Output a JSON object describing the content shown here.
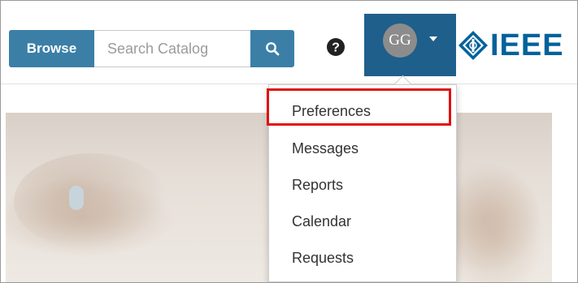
{
  "header": {
    "browse_label": "Browse",
    "search_placeholder": "Search Catalog",
    "user_initials": "GG",
    "logo_text": "IEEE"
  },
  "menu": {
    "items": [
      {
        "label": "Preferences"
      },
      {
        "label": "Messages"
      },
      {
        "label": "Reports"
      },
      {
        "label": "Calendar"
      },
      {
        "label": "Requests"
      }
    ]
  },
  "icons": {
    "search": "search-icon",
    "help": "help-icon",
    "caret": "caret-down-icon",
    "logo": "ieee-diamond-icon"
  },
  "colors": {
    "brand_blue": "#3b7fa7",
    "user_area": "#1f5f8b",
    "logo_blue": "#00629b",
    "highlight_red": "#e01010"
  }
}
